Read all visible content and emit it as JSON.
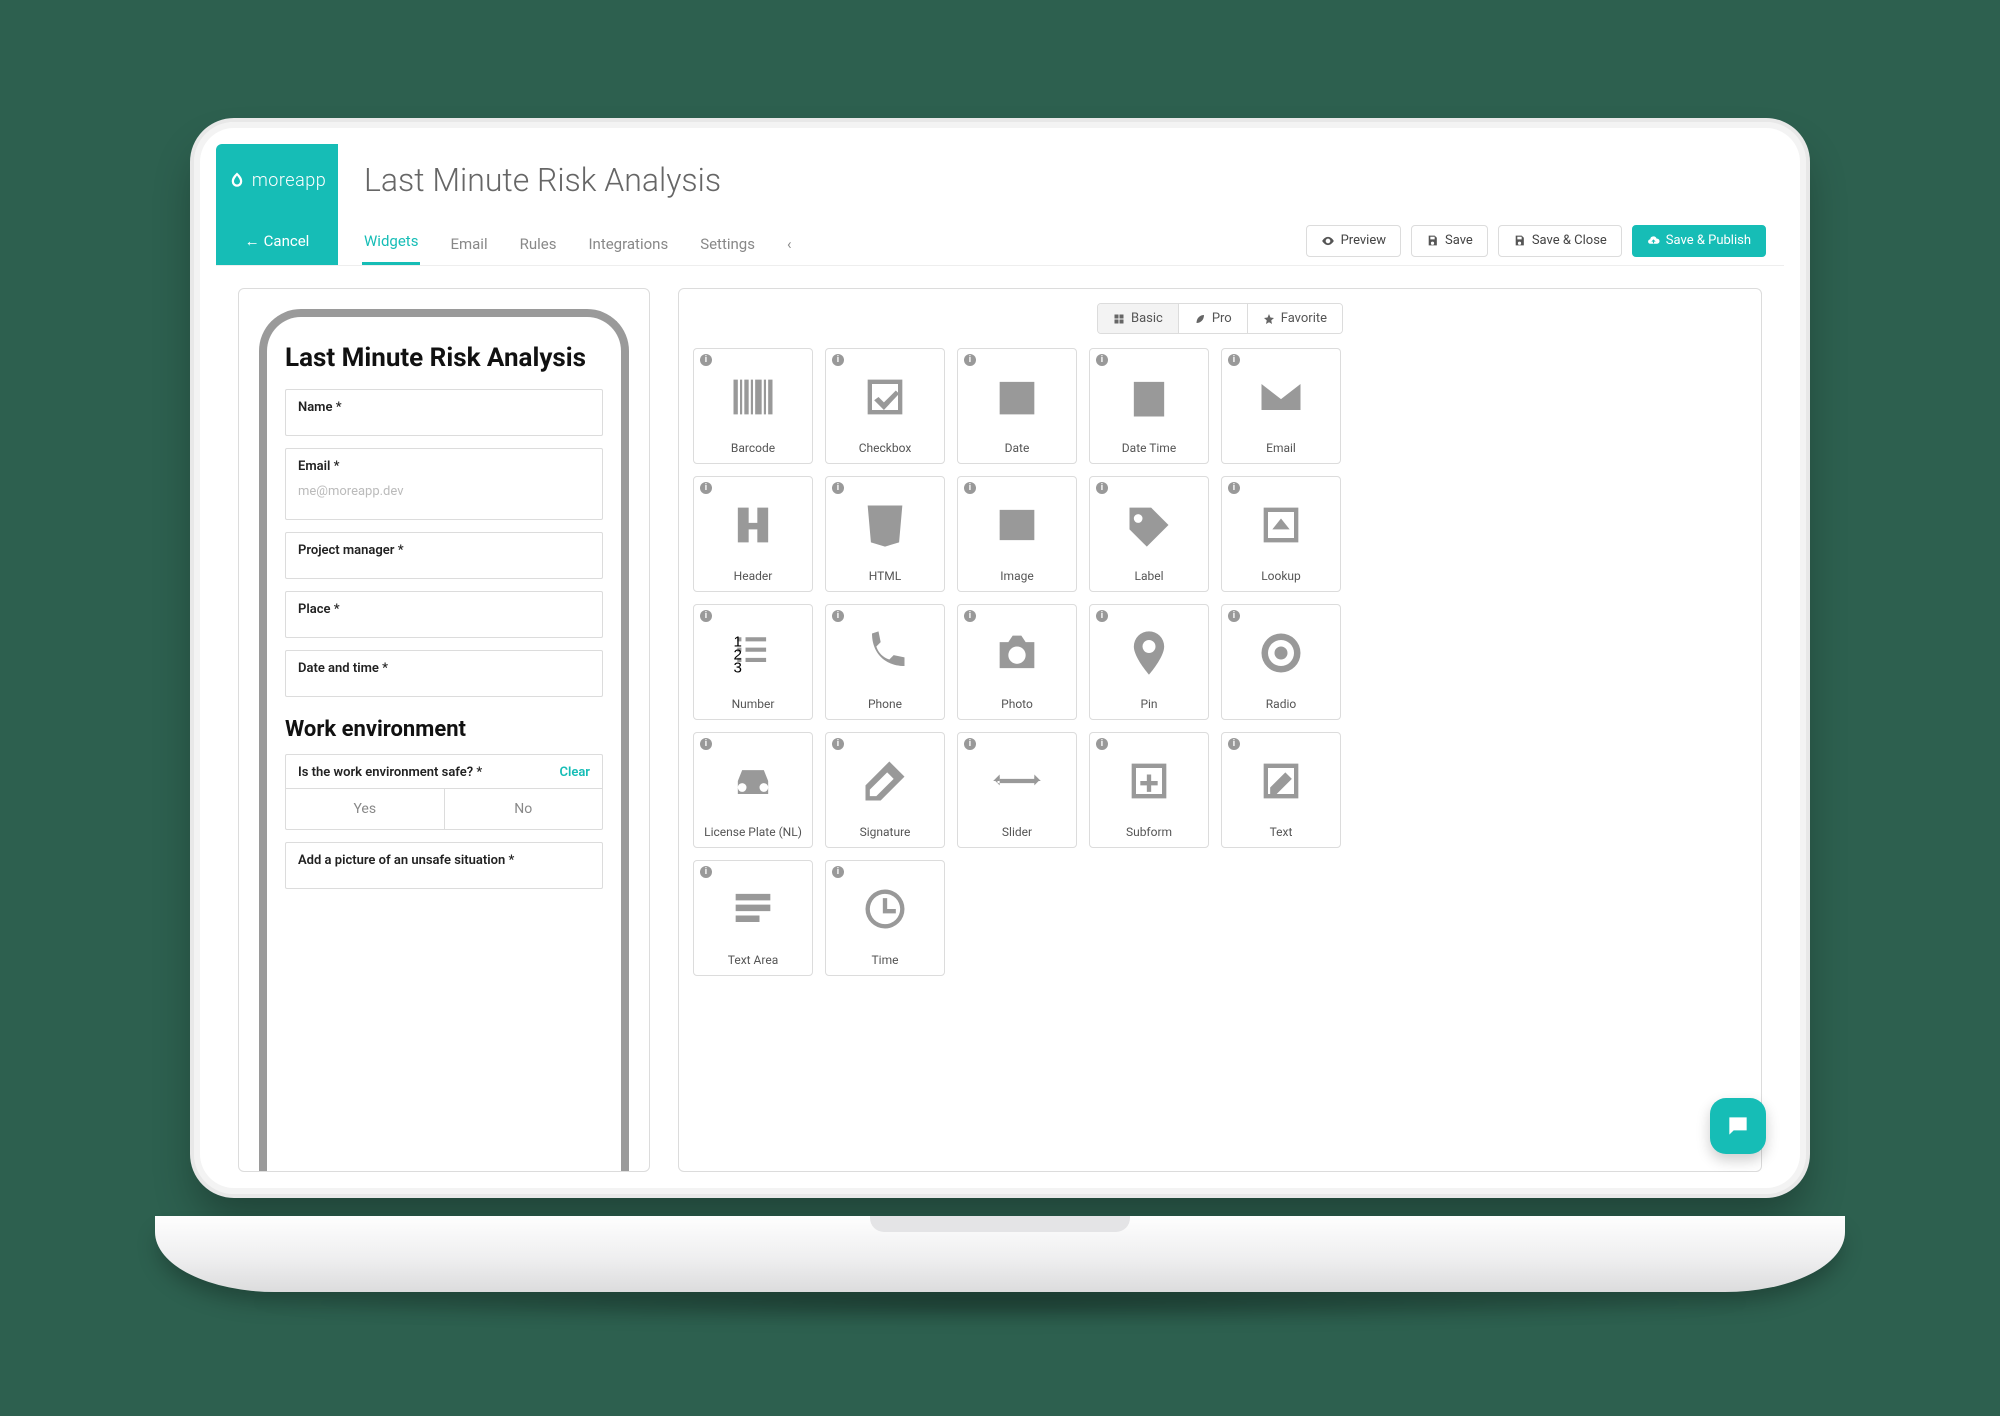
{
  "brand": {
    "name": "moreapp"
  },
  "page_title": "Last Minute Risk Analysis",
  "cancel_label": "Cancel",
  "tabs": {
    "widgets": "Widgets",
    "email": "Email",
    "rules": "Rules",
    "integrations": "Integrations",
    "settings": "Settings"
  },
  "actions": {
    "preview": "Preview",
    "save": "Save",
    "save_close": "Save & Close",
    "save_publish": "Save & Publish"
  },
  "form": {
    "title": "Last Minute Risk Analysis",
    "fields": {
      "name": "Name *",
      "email": "Email *",
      "email_placeholder": "me@moreapp.dev",
      "project_manager": "Project manager *",
      "place": "Place *",
      "date_time": "Date and time *"
    },
    "section": "Work environment",
    "question": {
      "label": "Is the work environment safe? *",
      "clear": "Clear",
      "yes": "Yes",
      "no": "No"
    },
    "picture_field": "Add a picture of an unsafe situation *"
  },
  "categories": {
    "basic": "Basic",
    "pro": "Pro",
    "favorite": "Favorite"
  },
  "widgets": [
    {
      "id": "barcode",
      "label": "Barcode"
    },
    {
      "id": "checkbox",
      "label": "Checkbox"
    },
    {
      "id": "date",
      "label": "Date"
    },
    {
      "id": "datetime",
      "label": "Date Time"
    },
    {
      "id": "email",
      "label": "Email"
    },
    {
      "id": "header",
      "label": "Header"
    },
    {
      "id": "html",
      "label": "HTML"
    },
    {
      "id": "image",
      "label": "Image"
    },
    {
      "id": "label-widget",
      "label": "Label"
    },
    {
      "id": "lookup",
      "label": "Lookup"
    },
    {
      "id": "number",
      "label": "Number"
    },
    {
      "id": "phone",
      "label": "Phone"
    },
    {
      "id": "photo",
      "label": "Photo"
    },
    {
      "id": "pin",
      "label": "Pin"
    },
    {
      "id": "radio",
      "label": "Radio"
    },
    {
      "id": "license",
      "label": "License Plate (NL)"
    },
    {
      "id": "signature",
      "label": "Signature"
    },
    {
      "id": "slider",
      "label": "Slider"
    },
    {
      "id": "subform",
      "label": "Subform"
    },
    {
      "id": "text",
      "label": "Text"
    },
    {
      "id": "textarea",
      "label": "Text Area"
    },
    {
      "id": "time",
      "label": "Time"
    }
  ]
}
